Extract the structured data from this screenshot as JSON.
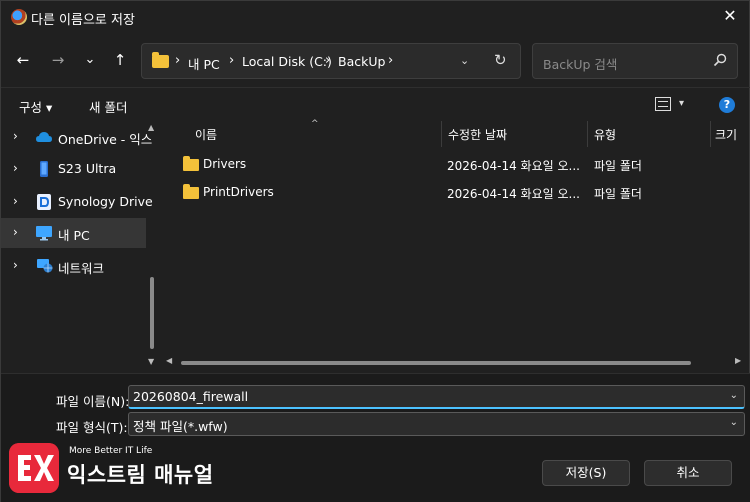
{
  "window": {
    "title": "다른 이름으로 저장",
    "close_glyph": "✕"
  },
  "nav": {
    "back_glyph": "←",
    "forward_glyph": "→",
    "recent_glyph": "⌄",
    "up_glyph": "↑",
    "breadcrumb": [
      "내 PC",
      "Local Disk (C:)",
      "BackUp"
    ],
    "separator": "›",
    "dropdown_glyph": "⌄",
    "refresh_glyph": "↻"
  },
  "search": {
    "placeholder": "BackUp 검색"
  },
  "toolbar": {
    "organize_label": "구성 ▾",
    "new_folder_label": "새 폴더",
    "view_dropdown_glyph": "▾",
    "help_glyph": "?"
  },
  "sidebar": {
    "items": [
      {
        "label": "OneDrive - 익스",
        "icon": "cloud-icon",
        "selected": false
      },
      {
        "label": "S23 Ultra",
        "icon": "phone-icon",
        "selected": false
      },
      {
        "label": "Synology Drive",
        "icon": "synology-icon",
        "selected": false
      },
      {
        "label": "내 PC",
        "icon": "monitor-icon",
        "selected": true
      },
      {
        "label": "네트워크",
        "icon": "network-icon",
        "selected": false
      }
    ],
    "chevron_glyph": "›"
  },
  "filelist": {
    "columns": [
      "이름",
      "수정한 날짜",
      "유형",
      "크기"
    ],
    "sort_glyph": "^",
    "rows": [
      {
        "name": "Drivers",
        "modified": "2026-04-14 화요일 오...",
        "type": "파일 폴더"
      },
      {
        "name": "PrintDrivers",
        "modified": "2026-04-14 화요일 오...",
        "type": "파일 폴더"
      }
    ]
  },
  "save_form": {
    "filename_label": "파일 이름(N):",
    "filename_value": "20260804_firewall",
    "filetype_label": "파일 형식(T):",
    "filetype_value": "정책 파일(*.wfw)",
    "dropdown_glyph": "⌄",
    "save_label": "저장(S)",
    "cancel_label": "취소"
  },
  "watermark": {
    "tagline": "More Better IT Life",
    "name": "익스트림 매뉴얼",
    "logo_text": "EX"
  },
  "colors": {
    "background": "#202020",
    "accent": "#4cc2ff",
    "folder": "#f3c13a",
    "help": "#1f7cd8",
    "watermark": "#e8293b"
  }
}
